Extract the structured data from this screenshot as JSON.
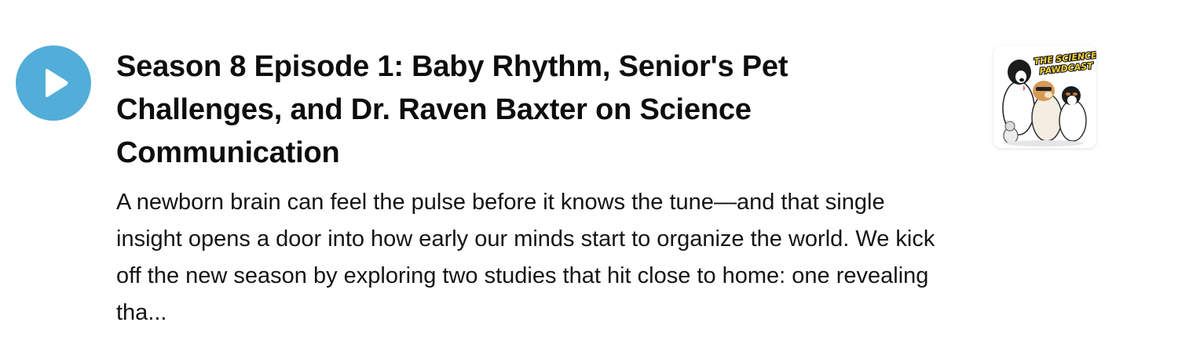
{
  "episode": {
    "title": "Season 8 Episode 1: Baby Rhythm, Senior's Pet Challenges, and Dr. Raven Baxter on Science Communication",
    "description": "A newborn brain can feel the pulse before it knows the tune—and that single insight opens a door into how early our minds start to organize the world. We kick off the new season by exploring two studies that hit close to home: one revealing tha...",
    "play_icon": "play-icon",
    "accent_color": "#52add8"
  },
  "podcast_artwork": {
    "line1": "THE SCIENCE",
    "line2": "PAWDCAST"
  }
}
